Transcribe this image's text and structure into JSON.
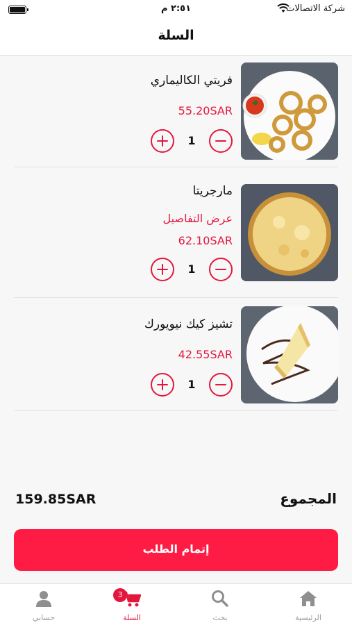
{
  "status_bar": {
    "carrier": "شركة الاتصالات",
    "time": "٢:٥١ م"
  },
  "header": {
    "title": "السلة"
  },
  "cart": {
    "items": [
      {
        "name": "فريتي الكاليماري",
        "price": "55.20SAR",
        "quantity": "1",
        "image_icon": "fried-calamari-photo"
      },
      {
        "name": "مارجريتا",
        "details_link": "عرض التفاصيل",
        "price": "62.10SAR",
        "quantity": "1",
        "image_icon": "margherita-pizza-photo"
      },
      {
        "name": "تشيز كيك نيويورك",
        "price": "42.55SAR",
        "quantity": "1",
        "image_icon": "cheesecake-photo"
      }
    ]
  },
  "summary": {
    "total_label": "المجموع",
    "total_value": "159.85SAR"
  },
  "checkout": {
    "label": "إتمام الطلب"
  },
  "tabs": {
    "home": {
      "label": "الرئيسية",
      "icon": "home-icon"
    },
    "search": {
      "label": "بحث",
      "icon": "search-icon"
    },
    "cart": {
      "label": "السلة",
      "icon": "cart-icon",
      "badge": "3"
    },
    "account": {
      "label": "حسابي",
      "icon": "user-icon"
    }
  },
  "colors": {
    "accent": "#fe1c44",
    "accent_text": "#e3173e",
    "inactive_tab": "#9a9a9a"
  }
}
